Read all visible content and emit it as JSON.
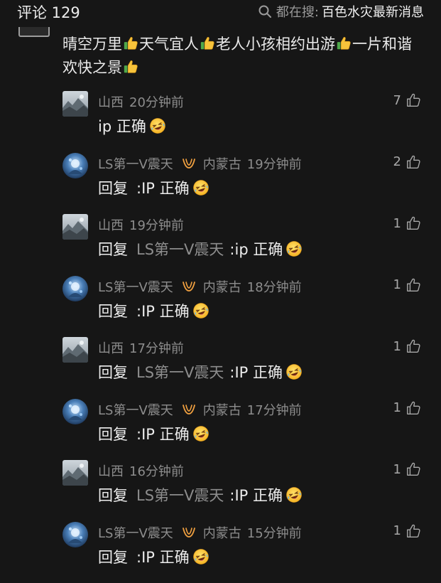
{
  "header": {
    "comment_count_label": "评论 129",
    "search_prefix": "都在搜:",
    "search_term": "百色水灾最新消息"
  },
  "parent_comment": {
    "segments": [
      "晴空万里",
      "天气宜人",
      "老人小孩相约出游",
      "一片和谐欢快之景"
    ],
    "emoji": "thumbs-up-emoji"
  },
  "replies": [
    {
      "avatar": "landscape-avatar",
      "username": "",
      "badge": false,
      "location": "山西",
      "time": "20分钟前",
      "reply_word": "",
      "reply_target": "",
      "text": "ip 正确",
      "emoji": "laughing-tears-emoji",
      "likes": "7"
    },
    {
      "avatar": "blue-flower-avatar",
      "username": "LS第一V震天",
      "badge": true,
      "location": "内蒙古",
      "time": "19分钟前",
      "reply_word": "回复",
      "reply_target": "",
      "text": ":IP 正确",
      "emoji": "laughing-tears-emoji",
      "likes": "2"
    },
    {
      "avatar": "landscape-avatar",
      "username": "",
      "badge": false,
      "location": "山西",
      "time": "19分钟前",
      "reply_word": "回复",
      "reply_target": "LS第一V震天",
      "text": ":ip 正确",
      "emoji": "laughing-tears-emoji",
      "likes": "1"
    },
    {
      "avatar": "blue-flower-avatar",
      "username": "LS第一V震天",
      "badge": true,
      "location": "内蒙古",
      "time": "18分钟前",
      "reply_word": "回复",
      "reply_target": "",
      "text": ":IP 正确",
      "emoji": "laughing-tears-emoji",
      "likes": "1"
    },
    {
      "avatar": "landscape-avatar",
      "username": "",
      "badge": false,
      "location": "山西",
      "time": "17分钟前",
      "reply_word": "回复",
      "reply_target": "LS第一V震天",
      "text": ":IP 正确",
      "emoji": "laughing-tears-emoji",
      "likes": "1"
    },
    {
      "avatar": "blue-flower-avatar",
      "username": "LS第一V震天",
      "badge": true,
      "location": "内蒙古",
      "time": "17分钟前",
      "reply_word": "回复",
      "reply_target": "",
      "text": ":IP 正确",
      "emoji": "laughing-tears-emoji",
      "likes": "1"
    },
    {
      "avatar": "landscape-avatar",
      "username": "",
      "badge": false,
      "location": "山西",
      "time": "16分钟前",
      "reply_word": "回复",
      "reply_target": "LS第一V震天",
      "text": ":IP 正确",
      "emoji": "laughing-tears-emoji",
      "likes": "1"
    },
    {
      "avatar": "blue-flower-avatar",
      "username": "LS第一V震天",
      "badge": true,
      "location": "内蒙古",
      "time": "15分钟前",
      "reply_word": "回复",
      "reply_target": "",
      "text": ":IP 正确",
      "emoji": "laughing-tears-emoji",
      "likes": "1"
    }
  ],
  "colors": {
    "background": "#161616",
    "primary_text": "#ededed",
    "secondary_text": "#8d8d8d",
    "badge_orange": "#f0a040"
  }
}
